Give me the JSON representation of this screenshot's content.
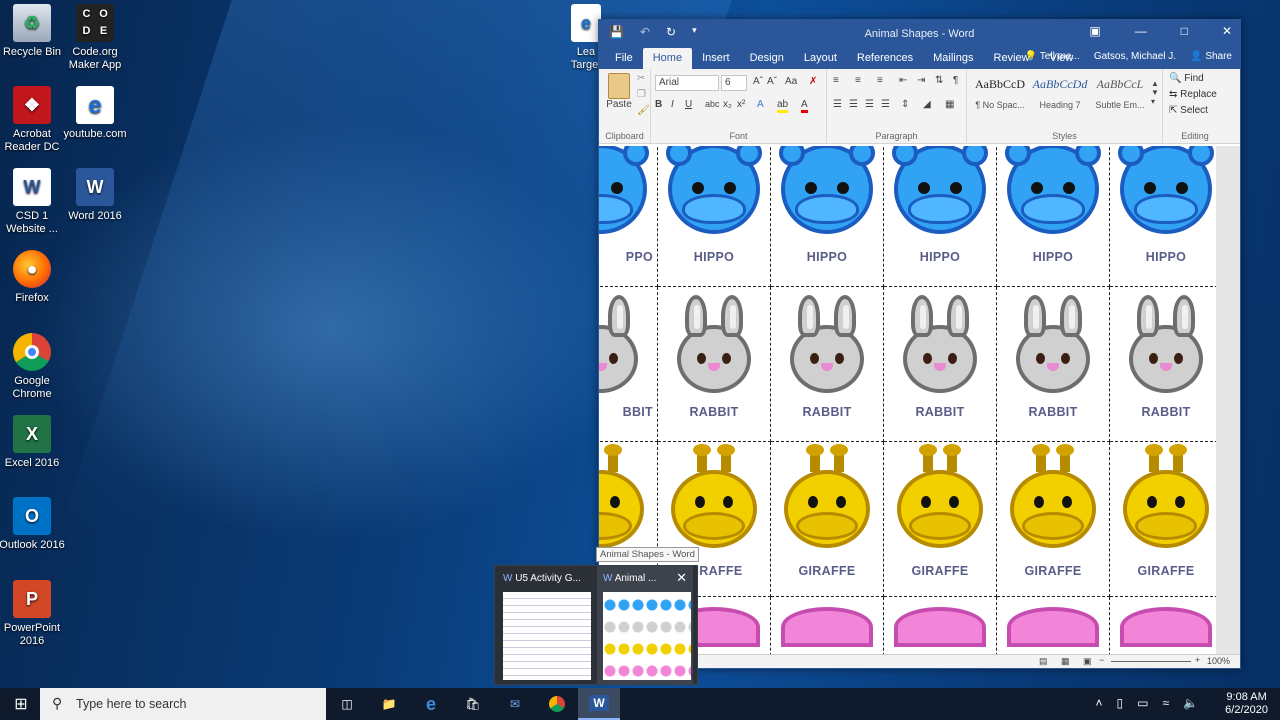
{
  "desktop": {
    "icons": [
      {
        "label": "Recycle Bin",
        "icon": "recycle-bin-icon"
      },
      {
        "label": "Code.org Maker App",
        "icon": "code-org-icon"
      },
      {
        "label": "Acrobat Reader DC",
        "icon": "acrobat-icon"
      },
      {
        "label": "youtube.com",
        "icon": "edge-icon"
      },
      {
        "label": "CSD 1 Website ...",
        "icon": "word-doc-icon"
      },
      {
        "label": "Word 2016",
        "icon": "word-icon"
      },
      {
        "label": "Firefox",
        "icon": "firefox-icon"
      },
      {
        "label": "Google Chrome",
        "icon": "chrome-icon"
      },
      {
        "label": "Excel 2016",
        "icon": "excel-icon"
      },
      {
        "label": "Outlook 2016",
        "icon": "outlook-icon"
      },
      {
        "label": "PowerPoint 2016",
        "icon": "powerpoint-icon"
      },
      {
        "label": "Lea Target",
        "icon": "shortcut-icon"
      }
    ],
    "codeorg_letters": [
      "C",
      "O",
      "D",
      "E"
    ]
  },
  "word": {
    "title": "Animal Shapes - Word",
    "tabs": [
      "File",
      "Home",
      "Insert",
      "Design",
      "Layout",
      "References",
      "Mailings",
      "Review",
      "View"
    ],
    "active_tab": "Home",
    "tell_me": "Tell me...",
    "user": "Gatsos, Michael J.",
    "share": "Share",
    "font_name": "Arial",
    "font_size": "6",
    "groups": {
      "clipboard": "Clipboard",
      "font": "Font",
      "paragraph": "Paragraph",
      "styles": "Styles",
      "editing": "Editing"
    },
    "paste": "Paste",
    "styles": [
      {
        "sample": "AaBbCcD",
        "name": "¶ No Spac..."
      },
      {
        "sample": "AaBbCcDd",
        "name": "Heading 7"
      },
      {
        "sample": "AaBbCcL",
        "name": "Subtle Em..."
      }
    ],
    "editing": {
      "find": "Find",
      "replace": "Replace",
      "select": "Select"
    },
    "zoom": "100%",
    "animal_rows": [
      {
        "name": "HIPPO",
        "kind": "hippo",
        "first": "HIPPO"
      },
      {
        "name": "RABBIT",
        "kind": "rabbit",
        "first": "RABBIT"
      },
      {
        "name": "GIRAFFE",
        "kind": "giraffe",
        "first": "GIRAFFE"
      }
    ],
    "first_col_labels": [
      "PPO",
      "BBIT",
      "IRAFFE"
    ]
  },
  "taskbar": {
    "search_placeholder": "Type here to search",
    "time": "9:08 AM",
    "date": "6/2/2020"
  },
  "thumbnails": {
    "tooltip": "Animal Shapes - Word",
    "items": [
      {
        "title": "U5 Activity G..."
      },
      {
        "title": "Animal ..."
      }
    ]
  },
  "colors": {
    "word_blue": "#2b579a",
    "hippo": "#32a2f5",
    "rabbit": "#d0d0d0",
    "giraffe": "#f2d000",
    "label": "#5a5d8a"
  }
}
